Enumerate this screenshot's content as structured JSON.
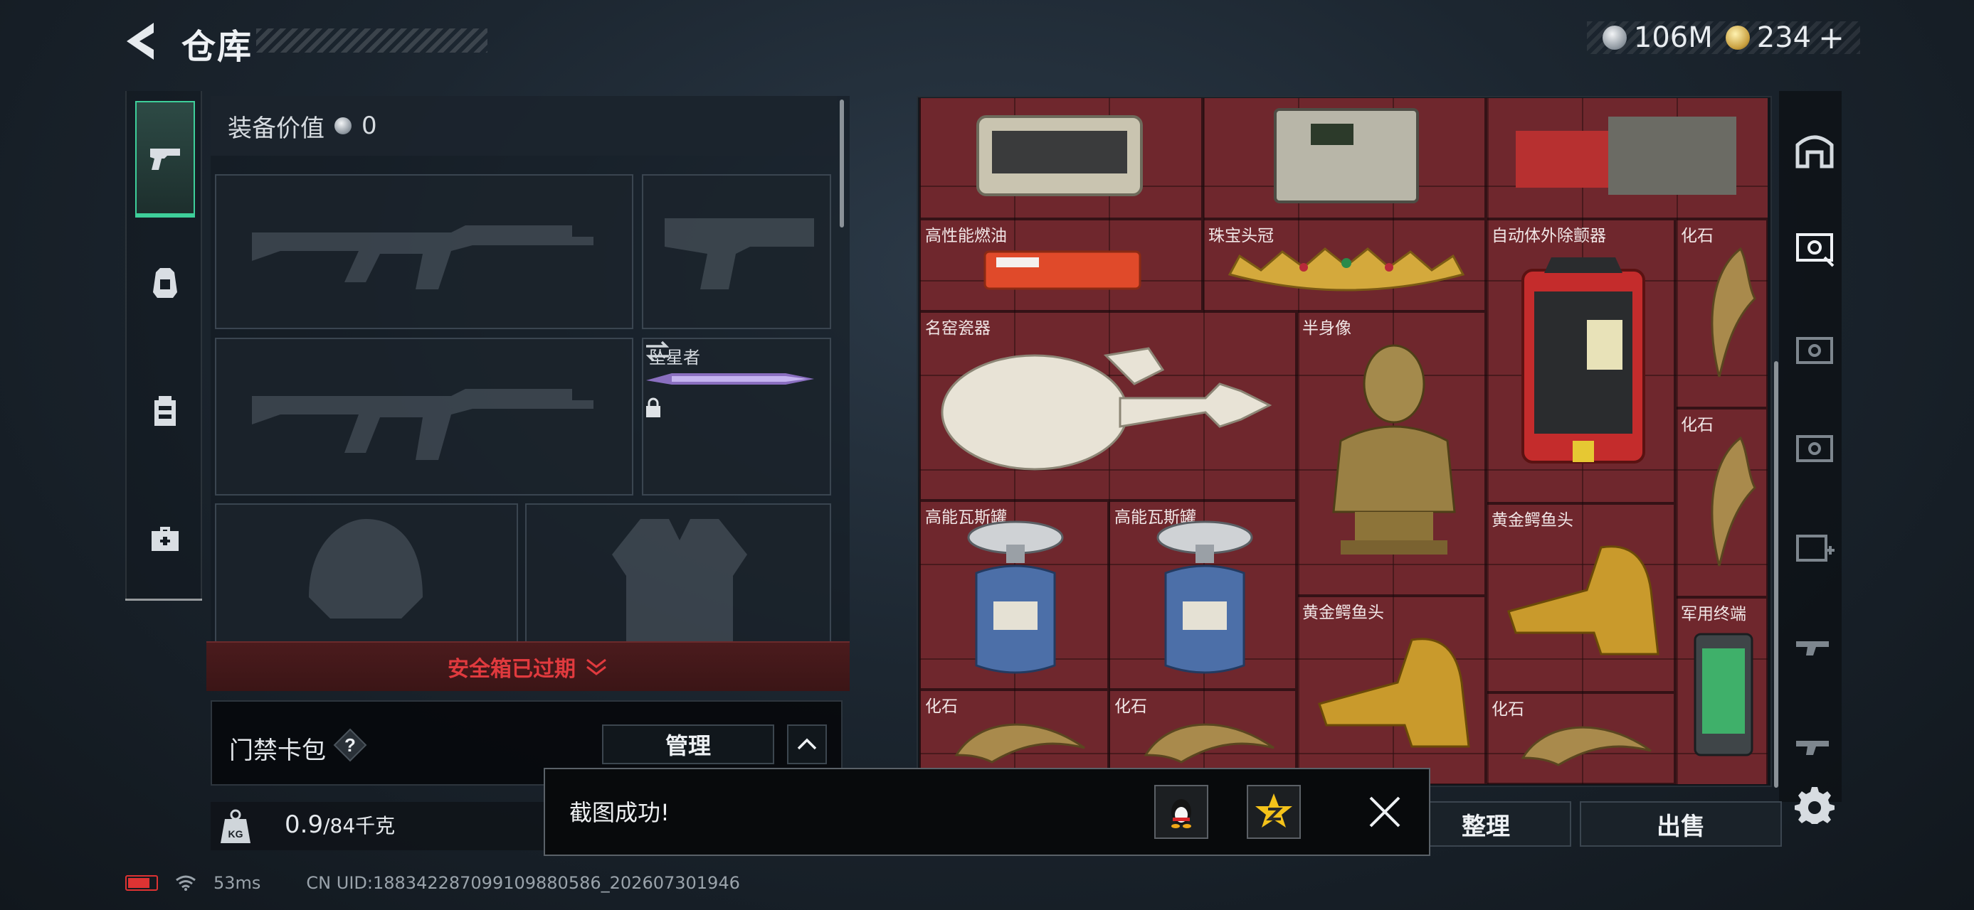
{
  "header": {
    "title": "仓库"
  },
  "currency": {
    "silver": "106M",
    "gold": "234",
    "gold_plus": "+"
  },
  "equipment": {
    "value_label": "装备价值",
    "value": "0",
    "melee_label": "坠星者",
    "safe_box_status": "安全箱已过期"
  },
  "access_card": {
    "label": "门禁卡包",
    "help": "?",
    "manage_label": "管理"
  },
  "weight": {
    "current": "0.9",
    "max": "/84千克",
    "icon_text": "KG"
  },
  "stash_items": [
    {
      "name": "高性能燃油"
    },
    {
      "name": "珠宝头冠"
    },
    {
      "name": "自动体外除颤器"
    },
    {
      "name": "化石"
    },
    {
      "name": "名窑瓷器"
    },
    {
      "name": "半身像"
    },
    {
      "name": "化石"
    },
    {
      "name": "高能瓦斯罐"
    },
    {
      "name": "高能瓦斯罐"
    },
    {
      "name": "黄金鳄鱼头"
    },
    {
      "name": "黄金鳄鱼头"
    },
    {
      "name": "军用终端"
    },
    {
      "name": "化石"
    },
    {
      "name": "化石"
    },
    {
      "name": "化石"
    }
  ],
  "bottom_buttons": {
    "sort": "整理",
    "sell": "出售"
  },
  "toast": {
    "message": "截图成功!"
  },
  "status": {
    "ping": "53ms",
    "uid": "CN UID:1883422870991098805​86_202607301946"
  },
  "colors": {
    "accent": "#3ecf9a",
    "warning": "#e03a3e",
    "stash_bg": "#6a262b"
  }
}
